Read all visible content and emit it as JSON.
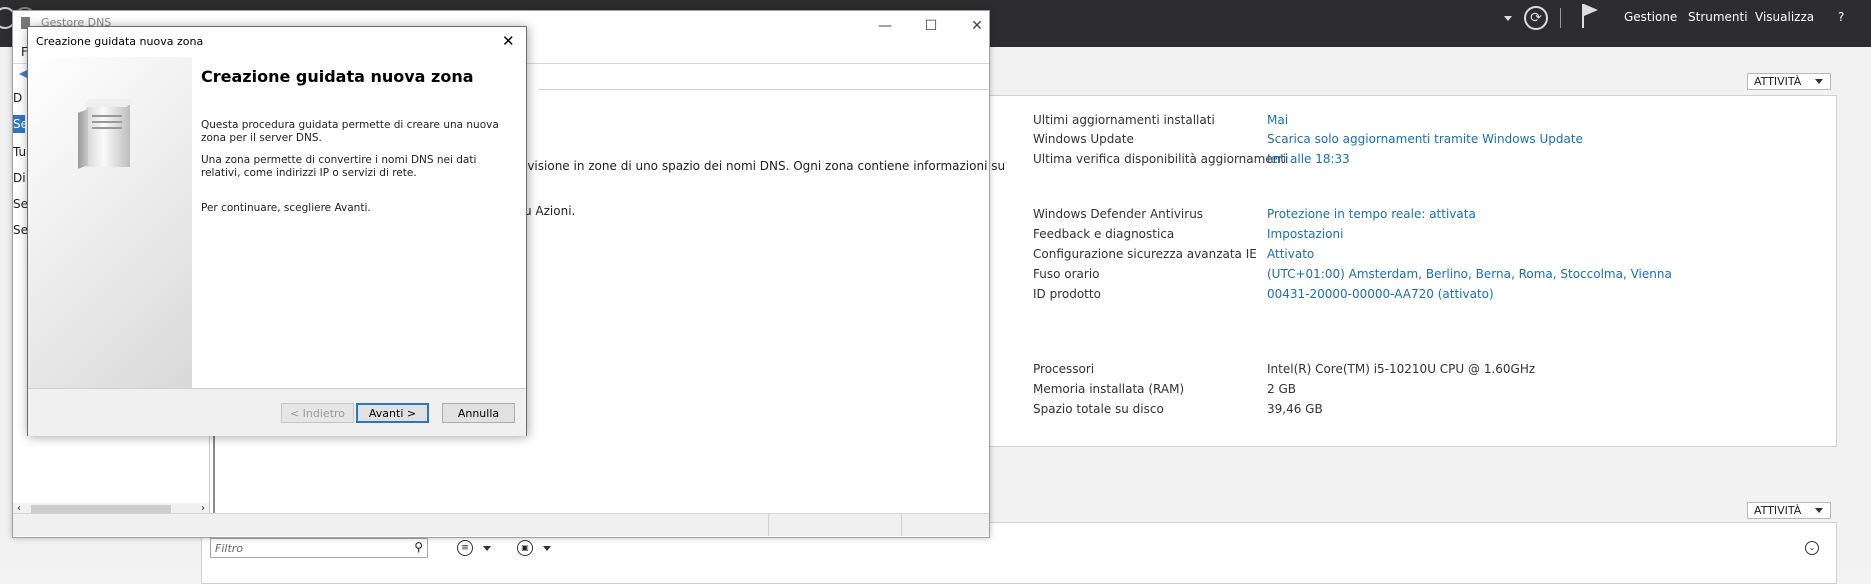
{
  "header": {
    "menus": [
      "Gestione",
      "Strumenti",
      "Visualizza"
    ],
    "help": "?"
  },
  "properties_panel": {
    "tasks_label": "ATTIVITÀ",
    "group1": [
      {
        "label": "Ultimi aggiornamenti installati",
        "value": "Mai"
      },
      {
        "label": "Windows Update",
        "value": "Scarica solo aggiornamenti tramite Windows Update"
      },
      {
        "label": "Ultima verifica disponibilità aggiornamenti",
        "value": "Ieri alle 18:33"
      }
    ],
    "group2": [
      {
        "label": "Windows Defender Antivirus",
        "value": "Protezione in tempo reale: attivata"
      },
      {
        "label": "Feedback e diagnostica",
        "value": "Impostazioni"
      },
      {
        "label": "Configurazione sicurezza avanzata IE",
        "value": "Attivato"
      },
      {
        "label": "Fuso orario",
        "value": "(UTC+01:00) Amsterdam, Berlino, Berna, Roma, Stoccolma, Vienna"
      },
      {
        "label": "ID prodotto",
        "value": "00431-20000-00000-AA720 (attivato)"
      }
    ],
    "group3": [
      {
        "label": "Processori",
        "value": "Intel(R) Core(TM) i5-10210U CPU @ 1.60GHz"
      },
      {
        "label": "Memoria installata (RAM)",
        "value": "2 GB"
      },
      {
        "label": "Spazio totale su disco",
        "value": "39,46 GB"
      }
    ]
  },
  "events_panel": {
    "tasks_label": "ATTIVITÀ",
    "filter_placeholder": "Filtro"
  },
  "dns_window": {
    "title": "Gestore DNS",
    "menu_first": "F",
    "tree_letters": [
      "D",
      "Se",
      "Tu",
      "Di",
      "Se",
      "Se"
    ],
    "text_line1": "ivisione in zone di uno spazio dei nomi DNS. Ogni zona contiene informazioni su",
    "text_line2": "u Azioni.",
    "controls": {
      "minimize": "—",
      "maximize": "☐",
      "close": "✕"
    }
  },
  "wizard": {
    "title": "Creazione guidata nuova zona",
    "heading": "Creazione guidata nuova zona",
    "para1": "Questa procedura guidata permette di creare una nuova zona per il server DNS.",
    "para2": "Una zona permette di convertire i nomi DNS nei dati relativi, come indirizzi IP o servizi di rete.",
    "para3": "Per continuare, scegliere Avanti.",
    "btn_back": "< Indietro",
    "btn_next": "Avanti >",
    "btn_cancel": "Annulla",
    "close": "✕"
  }
}
